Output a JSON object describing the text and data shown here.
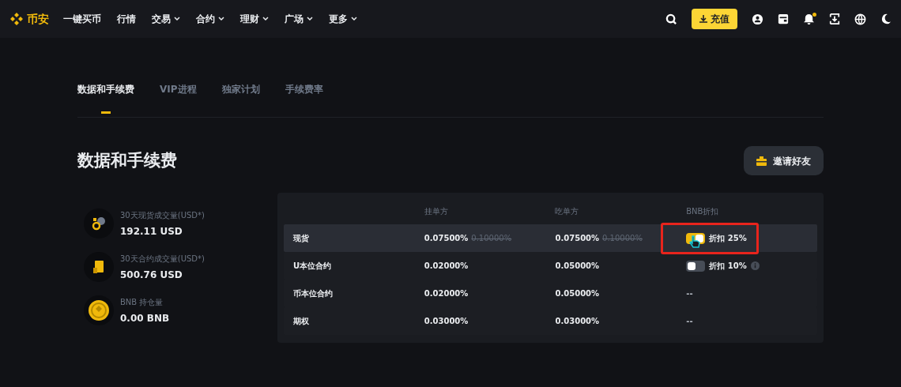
{
  "nav": {
    "logo": "币安",
    "items": [
      {
        "label": "一键买币",
        "dropdown": false
      },
      {
        "label": "行情",
        "dropdown": false
      },
      {
        "label": "交易",
        "dropdown": true
      },
      {
        "label": "合约",
        "dropdown": true
      },
      {
        "label": "理财",
        "dropdown": true
      },
      {
        "label": "广场",
        "dropdown": true
      },
      {
        "label": "更多",
        "dropdown": true
      }
    ],
    "deposit_button": "充值",
    "notification_dot": true
  },
  "tabs": [
    {
      "label": "数据和手续费",
      "selected": true
    },
    {
      "label": "VIP进程",
      "selected": false
    },
    {
      "label": "独家计划",
      "selected": false
    },
    {
      "label": "手续费率",
      "selected": false
    }
  ],
  "page_title": "数据和手续费",
  "invite_button": "邀请好友",
  "stats": [
    {
      "kind": "spot",
      "label": "30天现货成交量(USD*)",
      "value": "192.11 USD"
    },
    {
      "kind": "futures",
      "label": "30天合约成交量(USD*)",
      "value": "500.76 USD"
    },
    {
      "kind": "bnb",
      "label": "BNB 持仓量",
      "value": "0.00 BNB"
    }
  ],
  "fee_table": {
    "columns": [
      "挂单方",
      "吃单方",
      "BNB折扣"
    ],
    "rows": [
      {
        "name": "现货",
        "maker": "0.07500%",
        "maker_old": "0.10000%",
        "taker": "0.07500%",
        "taker_old": "0.10000%",
        "selected": true,
        "discount": {
          "kind": "toggle",
          "on": true,
          "label": "折扣 25%",
          "info": false,
          "highlighted": true
        }
      },
      {
        "name": "U本位合约",
        "maker": "0.02000%",
        "taker": "0.05000%",
        "selected": false,
        "discount": {
          "kind": "toggle",
          "on": false,
          "label": "折扣 10%",
          "info": true,
          "highlighted": false
        }
      },
      {
        "name": "币本位合约",
        "maker": "0.02000%",
        "taker": "0.05000%",
        "selected": false,
        "discount": {
          "kind": "text",
          "label": "--"
        }
      },
      {
        "name": "期权",
        "maker": "0.03000%",
        "taker": "0.03000%",
        "selected": false,
        "discount": {
          "kind": "text",
          "label": "--"
        }
      }
    ]
  }
}
